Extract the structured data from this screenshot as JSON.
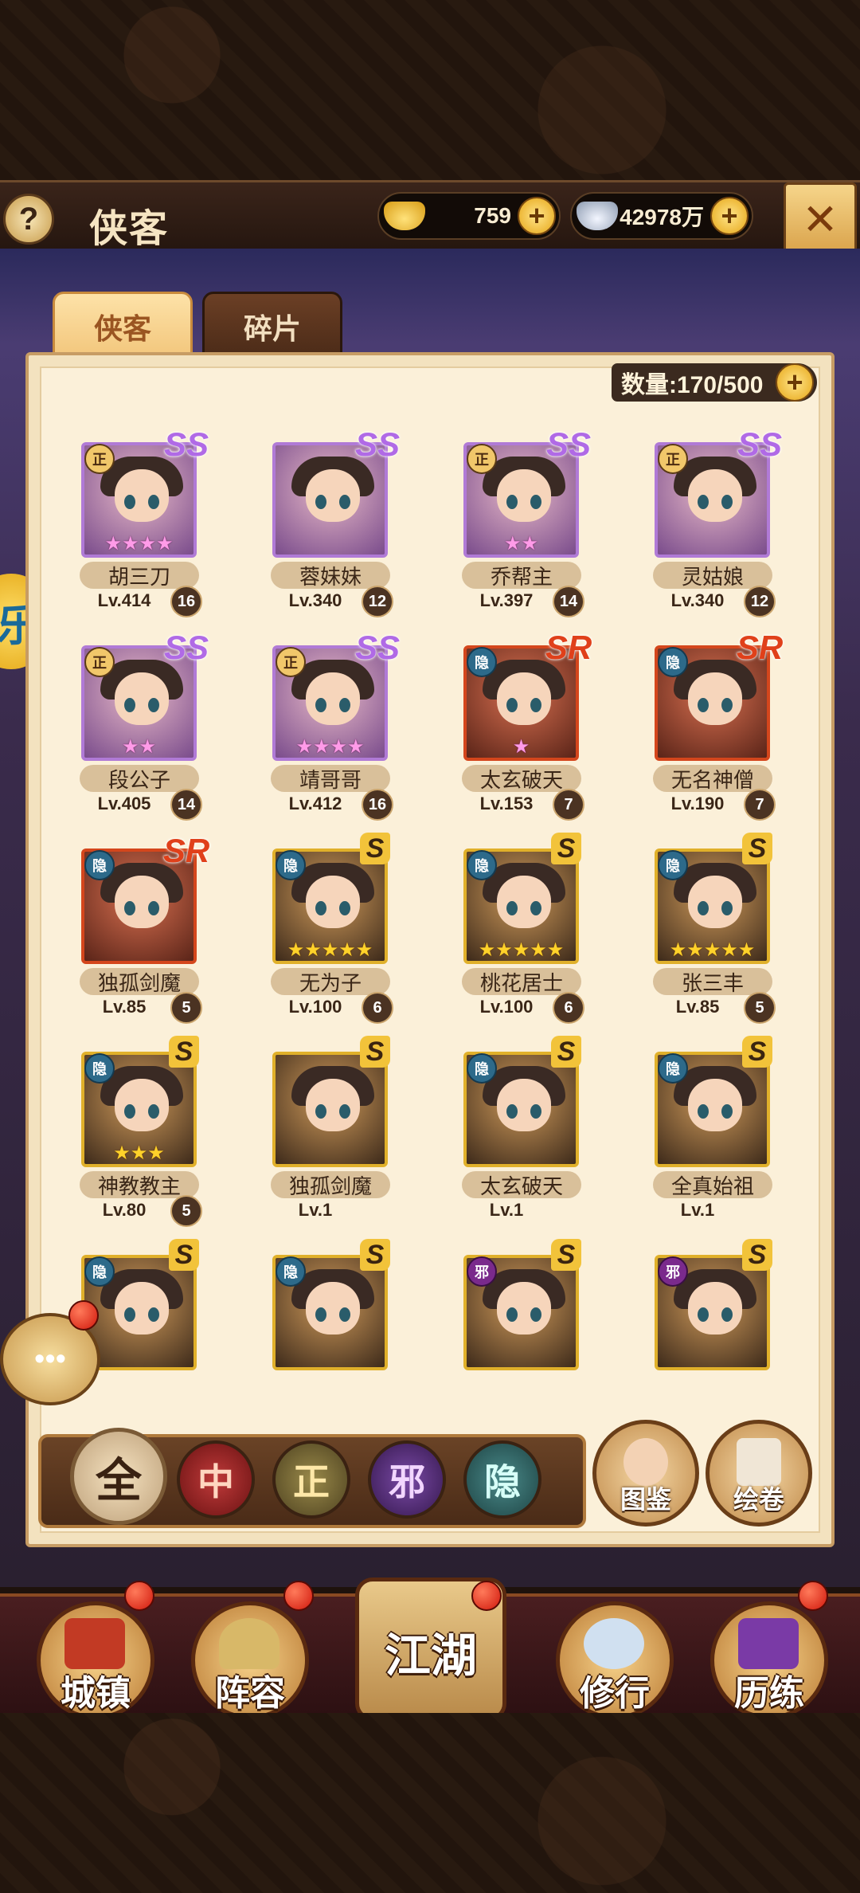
{
  "header": {
    "title": "侠客",
    "help_label": "?",
    "gold_value": "759",
    "silver_value": "42978万",
    "close_icon": "crossed-swords-close-icon"
  },
  "tabs": [
    {
      "label": "侠客",
      "active": true
    },
    {
      "label": "碎片",
      "active": false
    }
  ],
  "count": {
    "text": "数量:170/500"
  },
  "heroes": [
    {
      "name": "胡三刀",
      "level": "Lv.414",
      "badge": "16",
      "faction": "正",
      "grade": "SS",
      "stars": 4,
      "rarity": "purple"
    },
    {
      "name": "蓉妹妹",
      "level": "Lv.340",
      "badge": "12",
      "faction": "",
      "grade": "SS",
      "stars": 0,
      "rarity": "purple"
    },
    {
      "name": "乔帮主",
      "level": "Lv.397",
      "badge": "14",
      "faction": "正",
      "grade": "SS",
      "stars": 2,
      "rarity": "purple"
    },
    {
      "name": "灵姑娘",
      "level": "Lv.340",
      "badge": "12",
      "faction": "正",
      "grade": "SS",
      "stars": 0,
      "rarity": "purple"
    },
    {
      "name": "段公子",
      "level": "Lv.405",
      "badge": "14",
      "faction": "正",
      "grade": "SS",
      "stars": 2,
      "rarity": "purple"
    },
    {
      "name": "靖哥哥",
      "level": "Lv.412",
      "badge": "16",
      "faction": "正",
      "grade": "SS",
      "stars": 4,
      "rarity": "purple"
    },
    {
      "name": "太玄破天",
      "level": "Lv.153",
      "badge": "7",
      "faction": "隐",
      "grade": "SR",
      "stars": 1,
      "rarity": "red"
    },
    {
      "name": "无名神僧",
      "level": "Lv.190",
      "badge": "7",
      "faction": "隐",
      "grade": "SR",
      "stars": 0,
      "rarity": "red"
    },
    {
      "name": "独孤剑魔",
      "level": "Lv.85",
      "badge": "5",
      "faction": "隐",
      "grade": "SR",
      "stars": 0,
      "rarity": "red"
    },
    {
      "name": "无为子",
      "level": "Lv.100",
      "badge": "6",
      "faction": "隐",
      "grade": "S",
      "stars": 5,
      "rarity": "gold"
    },
    {
      "name": "桃花居士",
      "level": "Lv.100",
      "badge": "6",
      "faction": "隐",
      "grade": "S",
      "stars": 5,
      "rarity": "gold"
    },
    {
      "name": "张三丰",
      "level": "Lv.85",
      "badge": "5",
      "faction": "隐",
      "grade": "S",
      "stars": 5,
      "rarity": "gold"
    },
    {
      "name": "神教教主",
      "level": "Lv.80",
      "badge": "5",
      "faction": "隐",
      "grade": "S",
      "stars": 3,
      "rarity": "gold"
    },
    {
      "name": "独孤剑魔",
      "level": "Lv.1",
      "badge": "",
      "faction": "",
      "grade": "S",
      "stars": 0,
      "rarity": "gold"
    },
    {
      "name": "太玄破天",
      "level": "Lv.1",
      "badge": "",
      "faction": "隐",
      "grade": "S",
      "stars": 0,
      "rarity": "gold"
    },
    {
      "name": "全真始祖",
      "level": "Lv.1",
      "badge": "",
      "faction": "隐",
      "grade": "S",
      "stars": 0,
      "rarity": "gold"
    },
    {
      "name": "",
      "level": "",
      "badge": "",
      "faction": "隐",
      "grade": "S",
      "stars": 0,
      "rarity": "gold"
    },
    {
      "name": "",
      "level": "",
      "badge": "",
      "faction": "隐",
      "grade": "S",
      "stars": 0,
      "rarity": "gold"
    },
    {
      "name": "",
      "level": "",
      "badge": "",
      "faction": "邪",
      "grade": "S",
      "stars": 0,
      "rarity": "gold"
    },
    {
      "name": "",
      "level": "",
      "badge": "",
      "faction": "邪",
      "grade": "S",
      "stars": 0,
      "rarity": "gold"
    }
  ],
  "filters": {
    "all": "全",
    "middle": "中",
    "righteous": "正",
    "evil": "邪",
    "hidden": "隐"
  },
  "side_buttons": {
    "atlas": "图鉴",
    "scroll": "绘卷"
  },
  "nav": {
    "town": "城镇",
    "lineup": "阵容",
    "jianghu": "江湖",
    "cultivate": "修行",
    "training": "历练"
  },
  "colors": {
    "panel_bg": "#fbf0d9",
    "accent_gold": "#e6a515",
    "rarity_purple": "#b07ad6",
    "rarity_red": "#d4461c",
    "rarity_gold": "#e0b02a",
    "notify_red": "#d0180c"
  }
}
